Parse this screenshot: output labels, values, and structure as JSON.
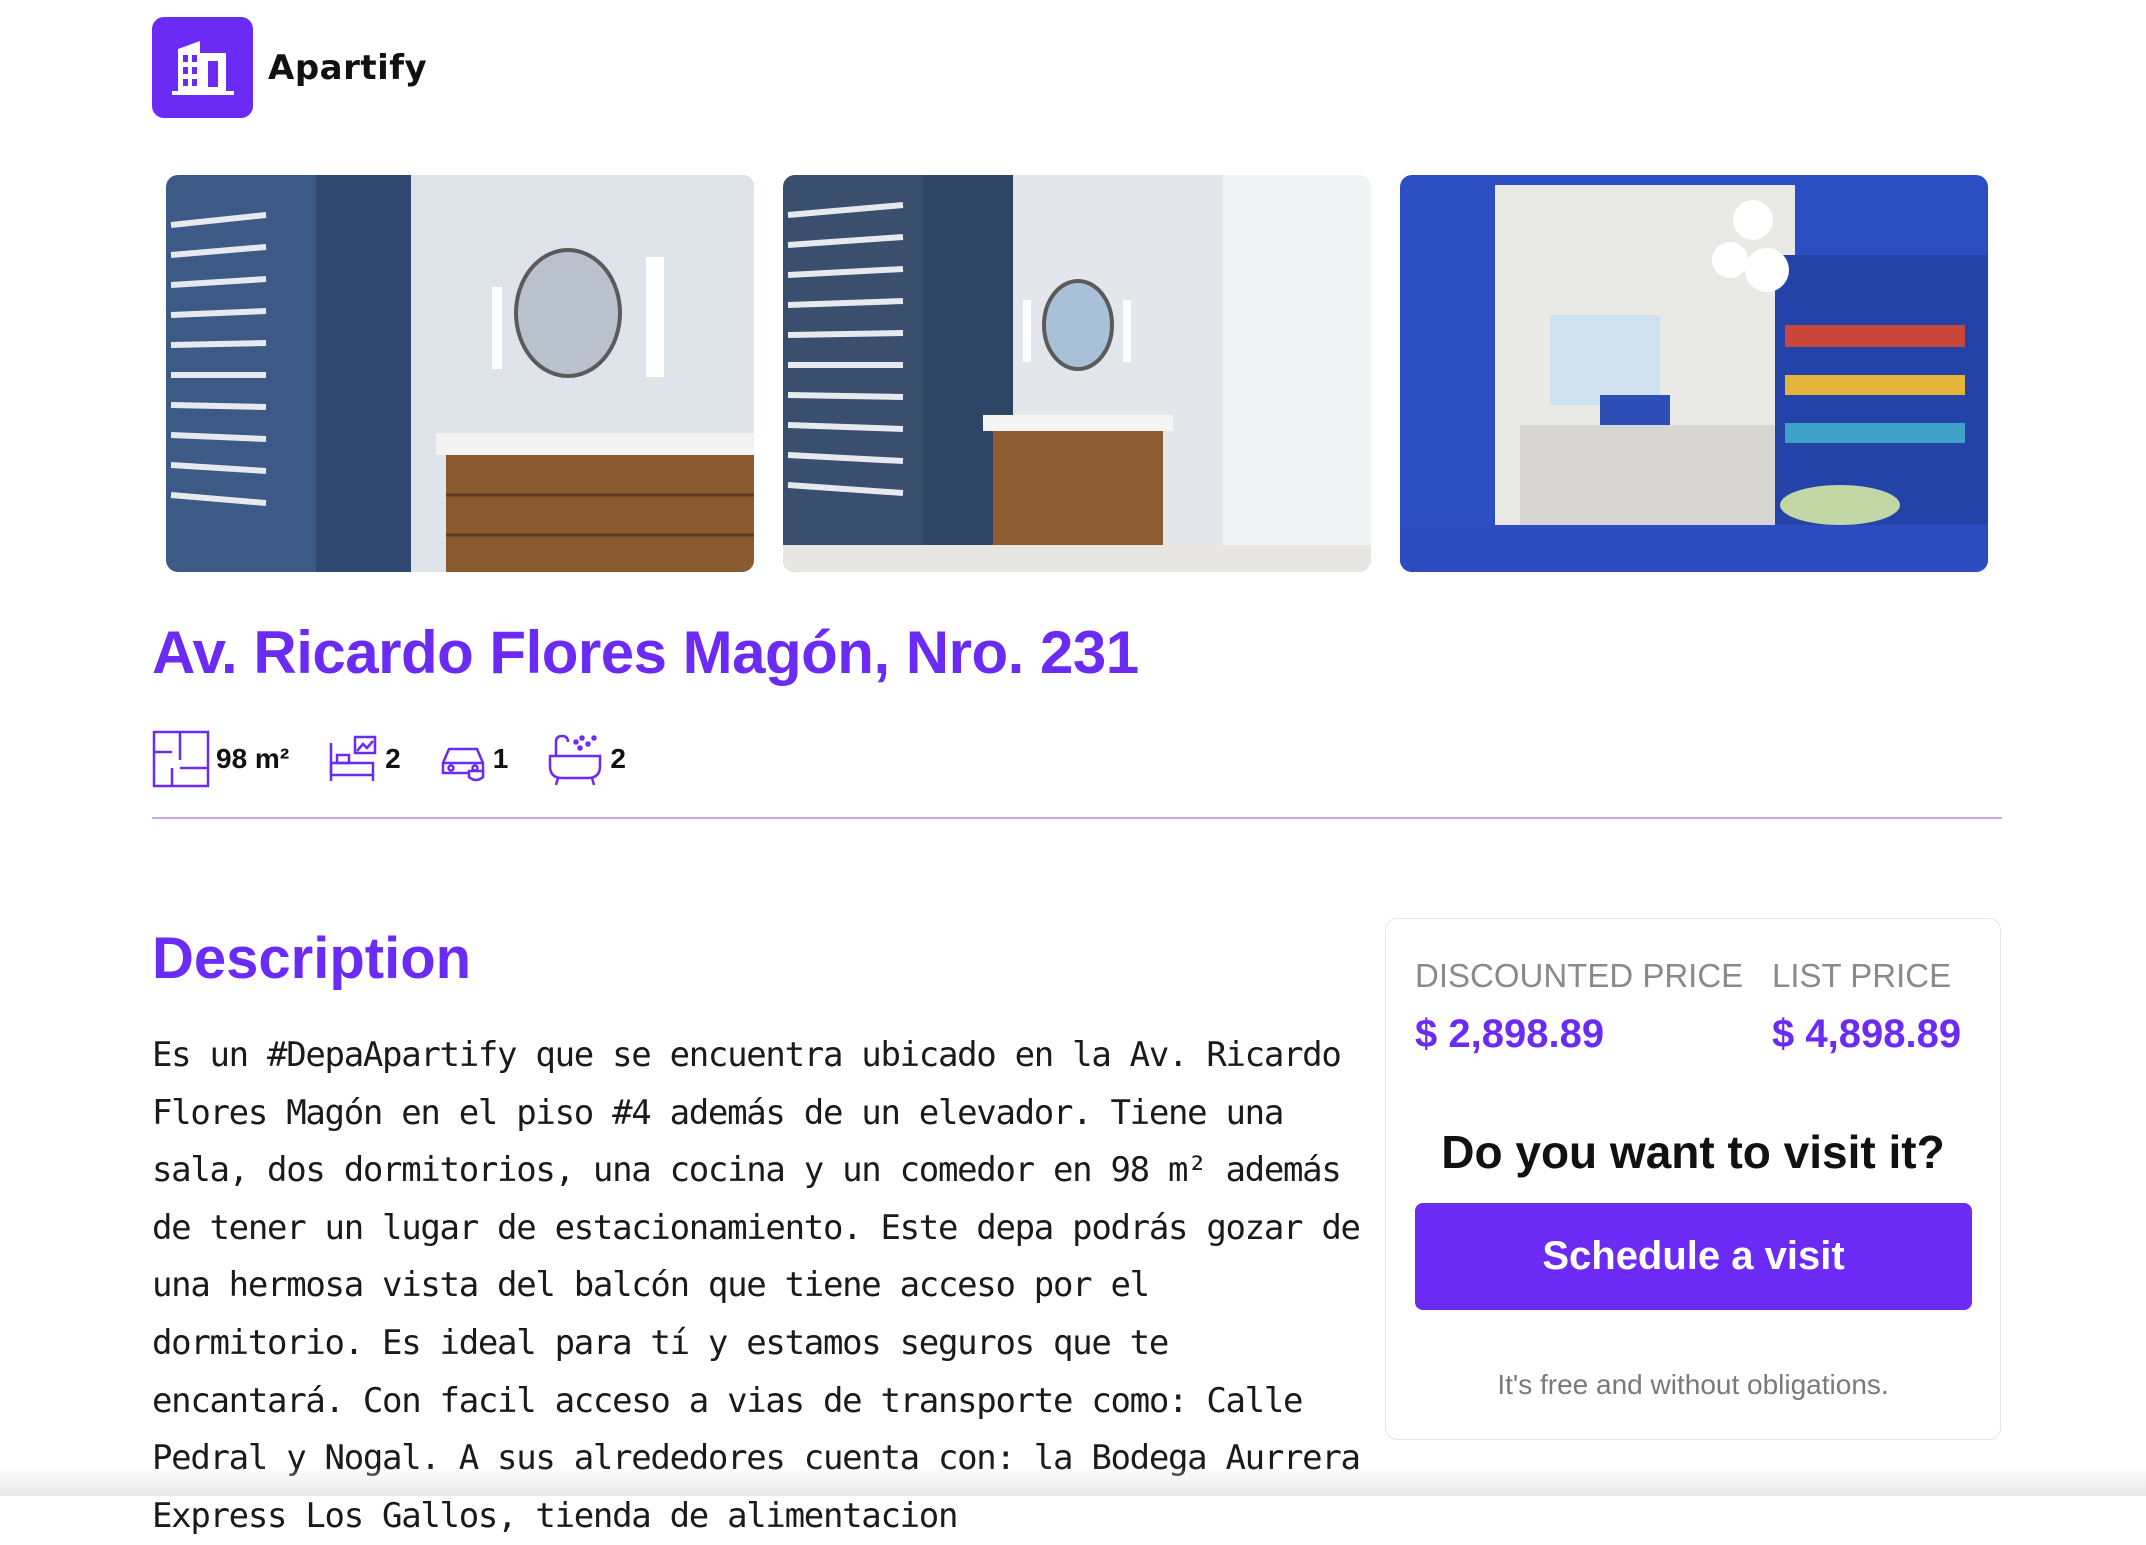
{
  "app": {
    "name": "Apartify",
    "logo_icon": "building-icon",
    "accent_color": "#6b2bf5"
  },
  "gallery": {
    "images": [
      {
        "name": "bathroom-photo-1",
        "alt": "Bathroom with round mirror and wooden vanity"
      },
      {
        "name": "bathroom-photo-2",
        "alt": "Bathroom with shower and towel rack"
      },
      {
        "name": "kids-room-photo",
        "alt": "Playroom with blue shelves and pendant lamps"
      }
    ]
  },
  "property": {
    "title": "Av. Ricardo Flores Magón, Nro. 231",
    "features": [
      {
        "icon": "floor-plan-icon",
        "value": "98 m²"
      },
      {
        "icon": "bed-icon",
        "value": "2"
      },
      {
        "icon": "car-icon",
        "value": "1"
      },
      {
        "icon": "bathtub-icon",
        "value": "2"
      }
    ]
  },
  "description": {
    "heading": "Description",
    "text": "Es un #DepaApartify que se encuentra ubicado en la Av. Ricardo Flores Magón en el piso #4 además de un elevador. Tiene una sala, dos dormitorios, una cocina y un comedor en 98 m² además de tener un lugar de estacionamiento. Este depa podrás gozar de una hermosa vista del balcón que tiene acceso por el dormitorio. Es ideal para tí y estamos seguros que te encantará. Con facil acceso a vias de transporte como: Calle Pedral y Nogal. A sus alrededores cuenta con: la Bodega Aurrera Express Los Gallos, tienda de alimentacion"
  },
  "pricing": {
    "discounted_label": "DISCOUNTED PRICE",
    "discounted_value": "$ 2,898.89",
    "list_label": "LIST PRICE",
    "list_value": "$ 4,898.89",
    "visit_question": "Do you want to visit it?",
    "visit_button": "Schedule a visit",
    "note": "It's free and without obligations."
  }
}
